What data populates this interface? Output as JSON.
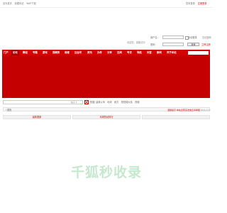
{
  "topbar": {
    "left_links": [
      "设为首页",
      "收藏本站",
      "WAP下载"
    ],
    "right_links": [
      {
        "label": "您未登录",
        "red": false
      },
      {
        "label": "注册登录",
        "red": true
      }
    ]
  },
  "login": {
    "welcome": "欢迎您，游客访问",
    "username_label": "用户名：",
    "password_label": "密码：",
    "auto_login": "自动登录",
    "forgot": "忘记密码",
    "register": "立即注册",
    "login_button": "登录"
  },
  "nav": {
    "items": [
      "门户",
      "论坛",
      "群组",
      "专题",
      "游戏",
      "视频秀",
      "商城",
      "社会号",
      "资讯",
      "办件",
      "分享",
      "见闻",
      "专访",
      "导航",
      "问答",
      "新闻",
      "关于本站"
    ],
    "active_index": 1,
    "search_label": "站内搜索"
  },
  "search": {
    "placeholder": "请输入搜索内容",
    "select_label": "帖子 ▾",
    "hot_label": "热搜:",
    "hot_words": [
      "建筑公司",
      "地块",
      "秘方",
      "短视频大赛",
      "视频"
    ]
  },
  "breadcrumb": "首页",
  "notice": {
    "text": "温馨提示:本站出现违法信息请举报",
    "time": "2024-2-16"
  },
  "tabs": [
    "最新更新",
    "本周热帖排行",
    "友情"
  ],
  "logo": "千狐秒收录",
  "colors": {
    "accent": "#d40000",
    "band": "#c40000",
    "logo": "#c6e8cf"
  }
}
